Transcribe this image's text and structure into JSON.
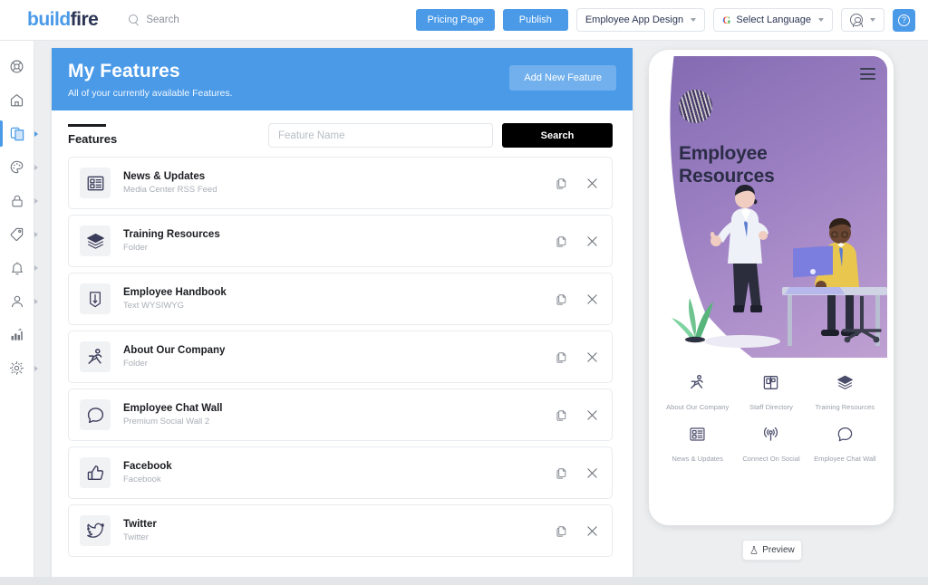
{
  "topbar": {
    "logo_build": "build",
    "logo_fire": "fire",
    "search_label": "Search",
    "pricing_button": "Pricing Page",
    "publish_button": "Publish",
    "app_selector": "Employee App Design",
    "language_selector": "Select Language",
    "google_mark": "G",
    "help_glyph": "?",
    "accent_blue": "#4a9ae8"
  },
  "sidebar": {
    "items": [
      {
        "name": "lifesaver",
        "icon": "lifesaver-icon",
        "active": false,
        "arrow": false
      },
      {
        "name": "home",
        "icon": "home-icon",
        "active": false,
        "arrow": false
      },
      {
        "name": "features",
        "icon": "layers-pages-icon",
        "active": true,
        "arrow": true
      },
      {
        "name": "design",
        "icon": "palette-icon",
        "active": false,
        "arrow": true
      },
      {
        "name": "security",
        "icon": "lock-icon",
        "active": false,
        "arrow": true
      },
      {
        "name": "marketing",
        "icon": "tag-icon",
        "active": false,
        "arrow": true
      },
      {
        "name": "notifications",
        "icon": "bell-icon",
        "active": false,
        "arrow": true
      },
      {
        "name": "users",
        "icon": "person-icon",
        "active": false,
        "arrow": true
      },
      {
        "name": "analytics",
        "icon": "bar-chart-icon",
        "active": false,
        "arrow": false
      },
      {
        "name": "settings",
        "icon": "gear-icon",
        "active": false,
        "arrow": true
      }
    ]
  },
  "panel": {
    "title": "My Features",
    "subtitle": "All of your currently available Features.",
    "add_button": "Add New Feature",
    "tab_label": "Features",
    "search_placeholder": "Feature Name",
    "search_value": "",
    "search_button": "Search"
  },
  "features": [
    {
      "title": "News & Updates",
      "subtitle": "Media Center RSS Feed",
      "icon": "news-list-icon"
    },
    {
      "title": "Training Resources",
      "subtitle": "Folder",
      "icon": "layers-icon"
    },
    {
      "title": "Employee Handbook",
      "subtitle": "Text WYSIWYG",
      "icon": "book-pen-icon"
    },
    {
      "title": "About Our Company",
      "subtitle": "Folder",
      "icon": "running-person-icon"
    },
    {
      "title": "Employee Chat Wall",
      "subtitle": "Premium Social Wall 2",
      "icon": "chat-bubble-icon"
    },
    {
      "title": "Facebook",
      "subtitle": "Facebook",
      "icon": "thumbs-up-icon"
    },
    {
      "title": "Twitter",
      "subtitle": "Twitter",
      "icon": "twitter-bird-icon"
    }
  ],
  "row_actions": {
    "duplicate": "duplicate-icon",
    "delete": "close-icon"
  },
  "phone": {
    "hero_title_line1": "Employee",
    "hero_title_line2": "Resources",
    "menu_icon": "hamburger-menu-icon",
    "logo_icon": "striped-sphere-logo",
    "grid": [
      {
        "label": "About Our Company",
        "icon": "running-person-icon"
      },
      {
        "label": "Staff Directory",
        "icon": "directory-grid-icon"
      },
      {
        "label": "Training Resources",
        "icon": "layers-icon"
      },
      {
        "label": "News & Updates",
        "icon": "news-list-icon"
      },
      {
        "label": "Connect On Social",
        "icon": "broadcast-icon"
      },
      {
        "label": "Employee Chat Wall",
        "icon": "chat-bubble-icon"
      }
    ]
  },
  "preview": {
    "label": "Preview",
    "icon": "flask-icon"
  }
}
